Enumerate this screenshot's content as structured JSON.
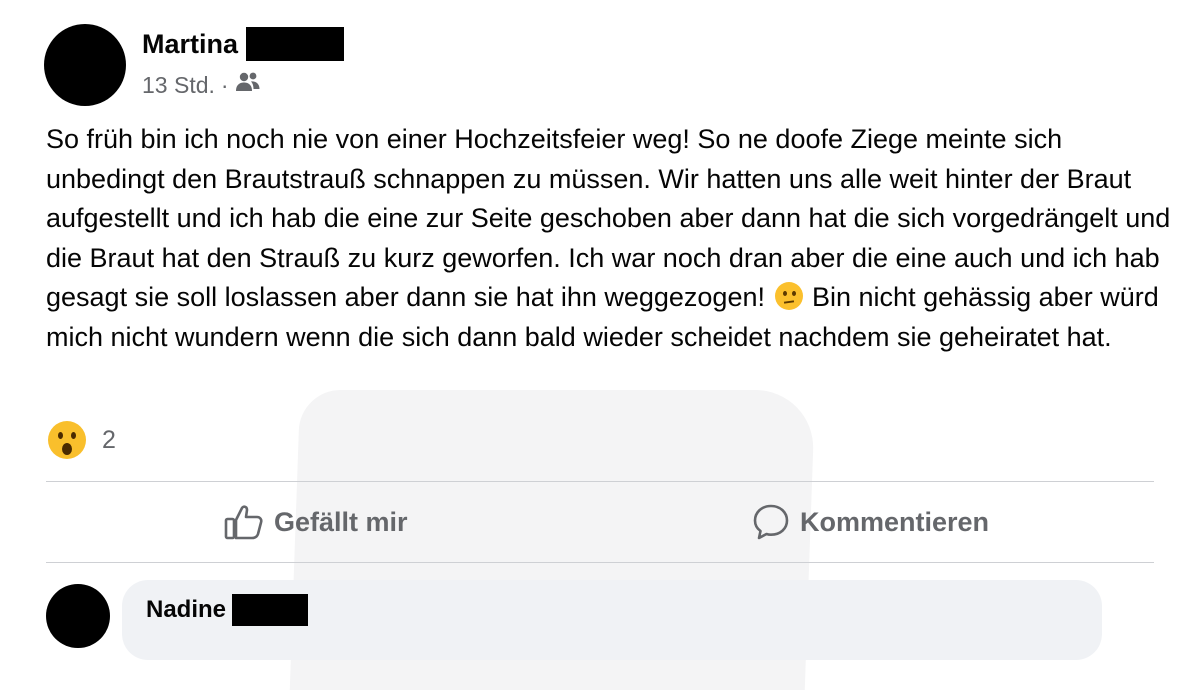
{
  "post": {
    "author_name": "Martina",
    "time": "13 Std.",
    "separator": "·",
    "audience_icon": "friends-icon",
    "text_part1": "So früh bin ich noch nie von einer Hochzeitsfeier weg! So ne doofe Ziege meinte sich unbedingt den Brautstrauß schnappen zu müssen. Wir hatten uns alle weit hinter der Braut aufgestellt und ich hab die eine zur Seite geschoben aber dann hat die sich vorgedrängelt und die Braut hat den Strauß zu kurz geworfen. Ich war noch dran aber die eine auch und ich hab gesagt sie soll loslassen aber dann sie hat ihn weggezogen!",
    "inline_emoji": "confused-face-icon",
    "text_part2": "Bin nicht gehässig aber würd mich nicht wundern wenn die sich dann bald wieder scheidet nachdem sie geheiratet hat.",
    "reaction_emoji": "wow-face-icon",
    "reaction_count": "2"
  },
  "actions": {
    "like_label": "Gefällt mir",
    "comment_label": "Kommentieren"
  },
  "comment": {
    "author_name": "Nadine"
  },
  "colors": {
    "secondary_text": "#65676b",
    "bubble_bg": "#f0f2f5",
    "divider": "#ced0d4"
  }
}
